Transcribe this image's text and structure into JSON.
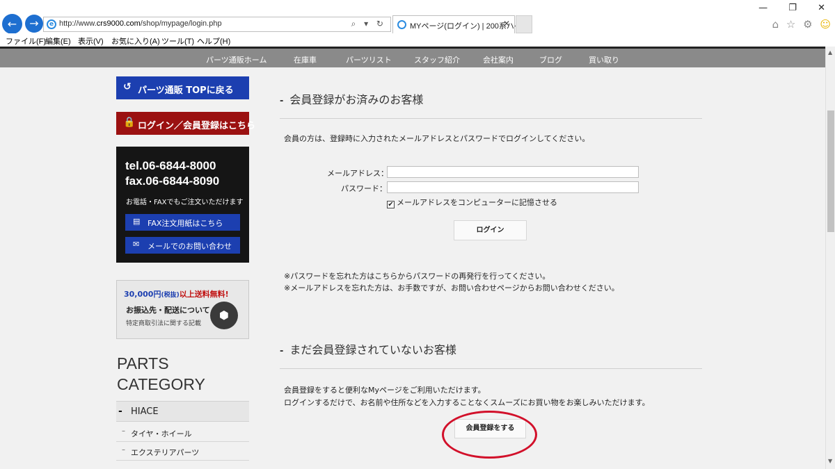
{
  "browser": {
    "address_prefix": "http://www.",
    "address_host": "crs9000.com",
    "address_path": "/shop/mypage/login.php",
    "address_tools": "⌕ ▾ ↻",
    "tab_title": "MYページ(ログイン) | 200系ハイ...",
    "tab_close": "✕",
    "back": "←",
    "forward": "→",
    "window_controls": [
      "—",
      "❐",
      "✕"
    ],
    "tool_icons": [
      "⌂",
      "☆",
      "⚙",
      "☺"
    ]
  },
  "menubar": [
    "ファイル(F)",
    "編集(E)",
    "表示(V)",
    "お気に入り(A)",
    "ツール(T)",
    "ヘルプ(H)"
  ],
  "topnav": [
    "パーツ通販ホーム",
    "在庫車",
    "パーツリスト",
    "スタッフ紹介",
    "会社案内",
    "ブログ",
    "買い取り"
  ],
  "sidebar": {
    "parts_top": "パーツ通販 TOPに戻る",
    "login": "ログイン／会員登録はこちら",
    "tel": "tel.06-6844-8000",
    "fax": "fax.06-6844-8090",
    "order_note": "お電話・FAXでもご注文いただけます",
    "fax_form": "FAX注文用紙はこちら",
    "mail": "メールでのお問い合わせ",
    "free_ship_amount": "30,000円",
    "free_ship_tax": "(税抜)",
    "free_ship_rest": "以上送料無料!",
    "ship_info": "お振込先・配送について",
    "ship_sub": "特定商取引法に関する記載",
    "category_title_1": "PARTS",
    "category_title_2": "CATEGORY",
    "category": "HIACE",
    "subcategories": [
      "タイヤ・ホイール",
      "エクステリアパーツ"
    ]
  },
  "main": {
    "members_heading": "会員登録がお済みのお客様",
    "members_intro": "会員の方は、登録時に入力されたメールアドレスとパスワードでログインしてください。",
    "email_label": "メールアドレス：",
    "password_label": "パスワード：",
    "email_value": "",
    "password_value": "",
    "remember_check": "✔",
    "remember_label": "メールアドレスをコンピューターに記憶させる",
    "login_button": "ログイン",
    "note_password": "※パスワードを忘れた方はこちらからパスワードの再発行を行ってください。",
    "note_email": "※メールアドレスを忘れた方は、お手数ですが、お問い合わせページからお問い合わせください。",
    "new_heading": "まだ会員登録されていないお客様",
    "new_intro_1": "会員登録をすると便利なMyページをご利用いただけます。",
    "new_intro_2": "ログインするだけで、お名前や住所などを入力することなくスムーズにお買い物をお楽しみいただけます。",
    "register_button": "会員登録をする"
  },
  "colors": {
    "accent_blue": "#1c3fb0",
    "accent_red": "#9b1111",
    "annotation_red": "#d2102a"
  }
}
